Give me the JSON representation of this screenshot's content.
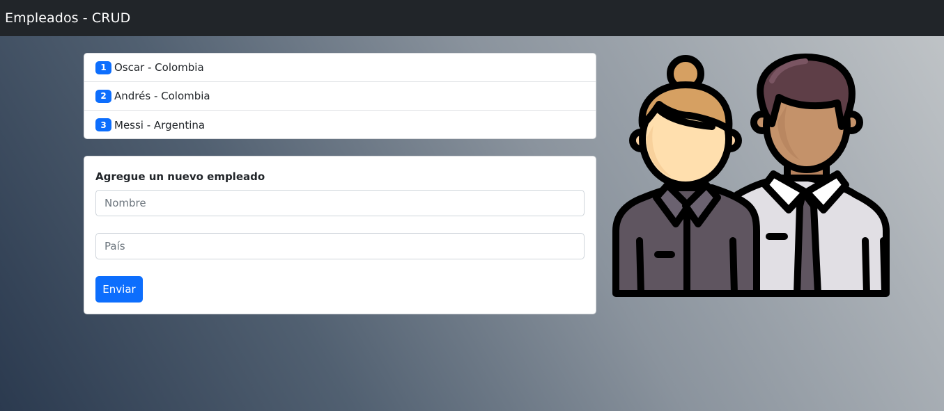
{
  "navbar": {
    "title": "Empleados - CRUD"
  },
  "employees": [
    {
      "id": "1",
      "label": "Oscar - Colombia"
    },
    {
      "id": "2",
      "label": "Andrés - Colombia"
    },
    {
      "id": "3",
      "label": "Messi - Argentina"
    }
  ],
  "form": {
    "title": "Agregue un nuevo empleado",
    "name_placeholder": "Nombre",
    "country_placeholder": "País",
    "submit_label": "Enviar"
  },
  "colors": {
    "navbar": "#212529",
    "primary": "#0d6efd"
  },
  "illustration": {
    "icon": "employees-illustration-icon"
  }
}
